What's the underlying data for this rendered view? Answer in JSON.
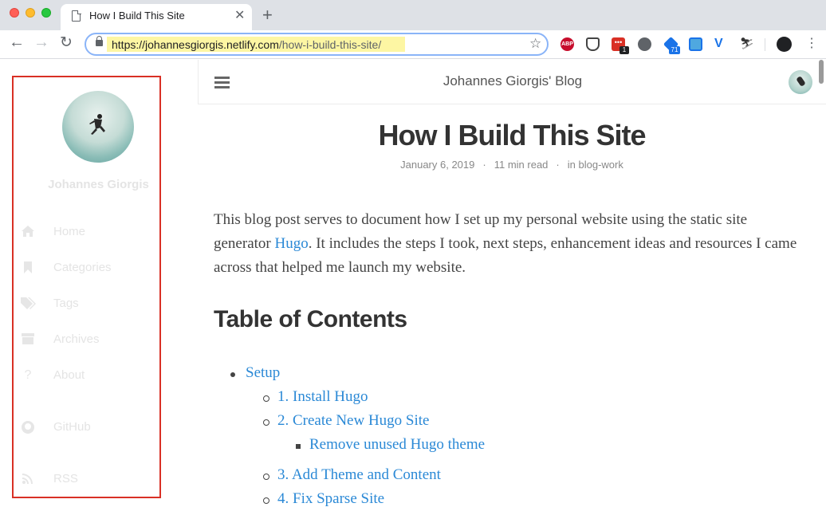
{
  "browser": {
    "tab_title": "How I Build This Site",
    "tab_close": "✕",
    "new_tab": "+",
    "url_host": "https://johannesgiorgis.netlify.com",
    "url_path": "/how-i-build-this-site/",
    "extensions": [
      "abp-icon",
      "pocket-icon",
      "todo-icon",
      "power-icon",
      "tag-icon",
      "grid-icon",
      "v-icon",
      "hat-icon",
      "avatar-icon"
    ],
    "ext_abp_label": "ABP",
    "ext_todo_label": "•••",
    "ext_badge_1": "1",
    "ext_badge_71": "71"
  },
  "sidebar": {
    "author_name": "Johannes Giorgis",
    "items": [
      {
        "label": "Home",
        "icon": "home-icon"
      },
      {
        "label": "Categories",
        "icon": "bookmark-icon"
      },
      {
        "label": "Tags",
        "icon": "tags-icon"
      },
      {
        "label": "Archives",
        "icon": "archive-icon"
      },
      {
        "label": "About",
        "icon": "question-icon"
      },
      {
        "label": "GitHub",
        "icon": "github-icon"
      },
      {
        "label": "RSS",
        "icon": "rss-icon"
      }
    ]
  },
  "header": {
    "blog_title": "Johannes Giorgis' Blog"
  },
  "post": {
    "title": "How I Build This Site",
    "date": "January 6, 2019",
    "read_time": "11 min read",
    "category_prefix": "in",
    "category": "blog-work",
    "intro_before_link": "This blog post serves to document how I set up my personal website using the static site generator ",
    "intro_link": "Hugo",
    "intro_after_link": ". It includes the steps I took, next steps, enhancement ideas and resources I came across that helped me launch my website.",
    "toc_heading": "Table of Contents",
    "toc": {
      "setup": "Setup",
      "install_hugo": "1. Install Hugo",
      "create_site": "2. Create New Hugo Site",
      "remove_theme": "Remove unused Hugo theme",
      "add_theme": "3. Add Theme and Content",
      "fix_sparse": "4. Fix Sparse Site"
    }
  },
  "colors": {
    "link": "#2b89d6",
    "highlight_box": "#d93025",
    "url_highlight": "#fdf6a3"
  }
}
